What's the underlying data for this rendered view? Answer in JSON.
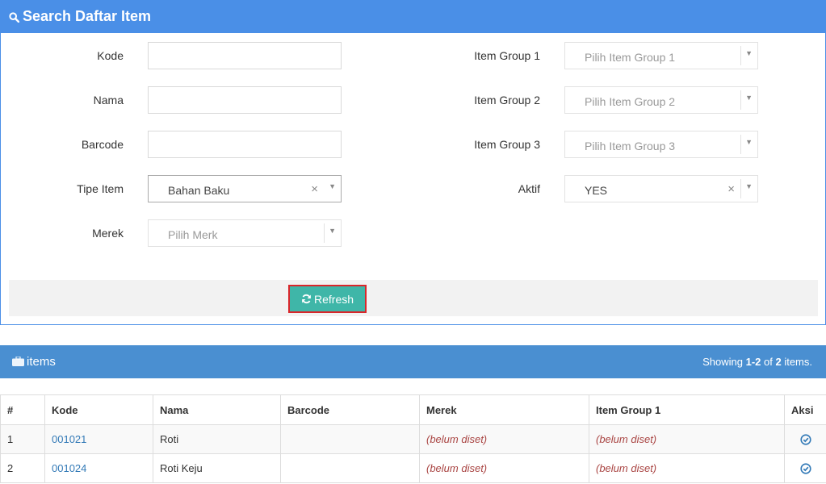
{
  "search": {
    "title": "Search Daftar Item",
    "fields_left": [
      {
        "label": "Kode",
        "value": ""
      },
      {
        "label": "Nama",
        "value": ""
      },
      {
        "label": "Barcode",
        "value": ""
      },
      {
        "label": "Tipe Item",
        "value": "Bahan Baku"
      },
      {
        "label": "Merek",
        "placeholder": "Pilih Merk"
      }
    ],
    "fields_right": [
      {
        "label": "Item Group 1",
        "placeholder": "Pilih Item Group 1"
      },
      {
        "label": "Item Group 2",
        "placeholder": "Pilih Item Group 2"
      },
      {
        "label": "Item Group 3",
        "placeholder": "Pilih Item Group 3"
      },
      {
        "label": "Aktif",
        "value": "YES"
      }
    ],
    "refresh_label": "Refresh"
  },
  "items": {
    "title": "items",
    "summary_prefix": "Showing ",
    "summary_range": "1-2",
    "summary_mid": " of ",
    "summary_total": "2",
    "summary_suffix": " items.",
    "columns": [
      "#",
      "Kode",
      "Nama",
      "Barcode",
      "Merek",
      "Item Group 1",
      "Aksi"
    ],
    "rows": [
      {
        "no": "1",
        "kode": "001021",
        "nama": "Roti",
        "barcode": "",
        "merek": "(belum diset)",
        "group1": "(belum diset)"
      },
      {
        "no": "2",
        "kode": "001024",
        "nama": "Roti Keju",
        "barcode": "",
        "merek": "(belum diset)",
        "group1": "(belum diset)"
      }
    ]
  },
  "colors": {
    "search_header": "#4a8fe7",
    "items_header": "#4a8fd1",
    "refresh_button": "#3fb6a8",
    "highlight_border": "#d9262a",
    "link": "#337ab7",
    "not_set": "#a94442"
  },
  "icons": {
    "search_header": "search-icon",
    "refresh_button": "refresh-icon",
    "items_header": "briefcase-icon",
    "row_action": "check-circle-icon"
  }
}
